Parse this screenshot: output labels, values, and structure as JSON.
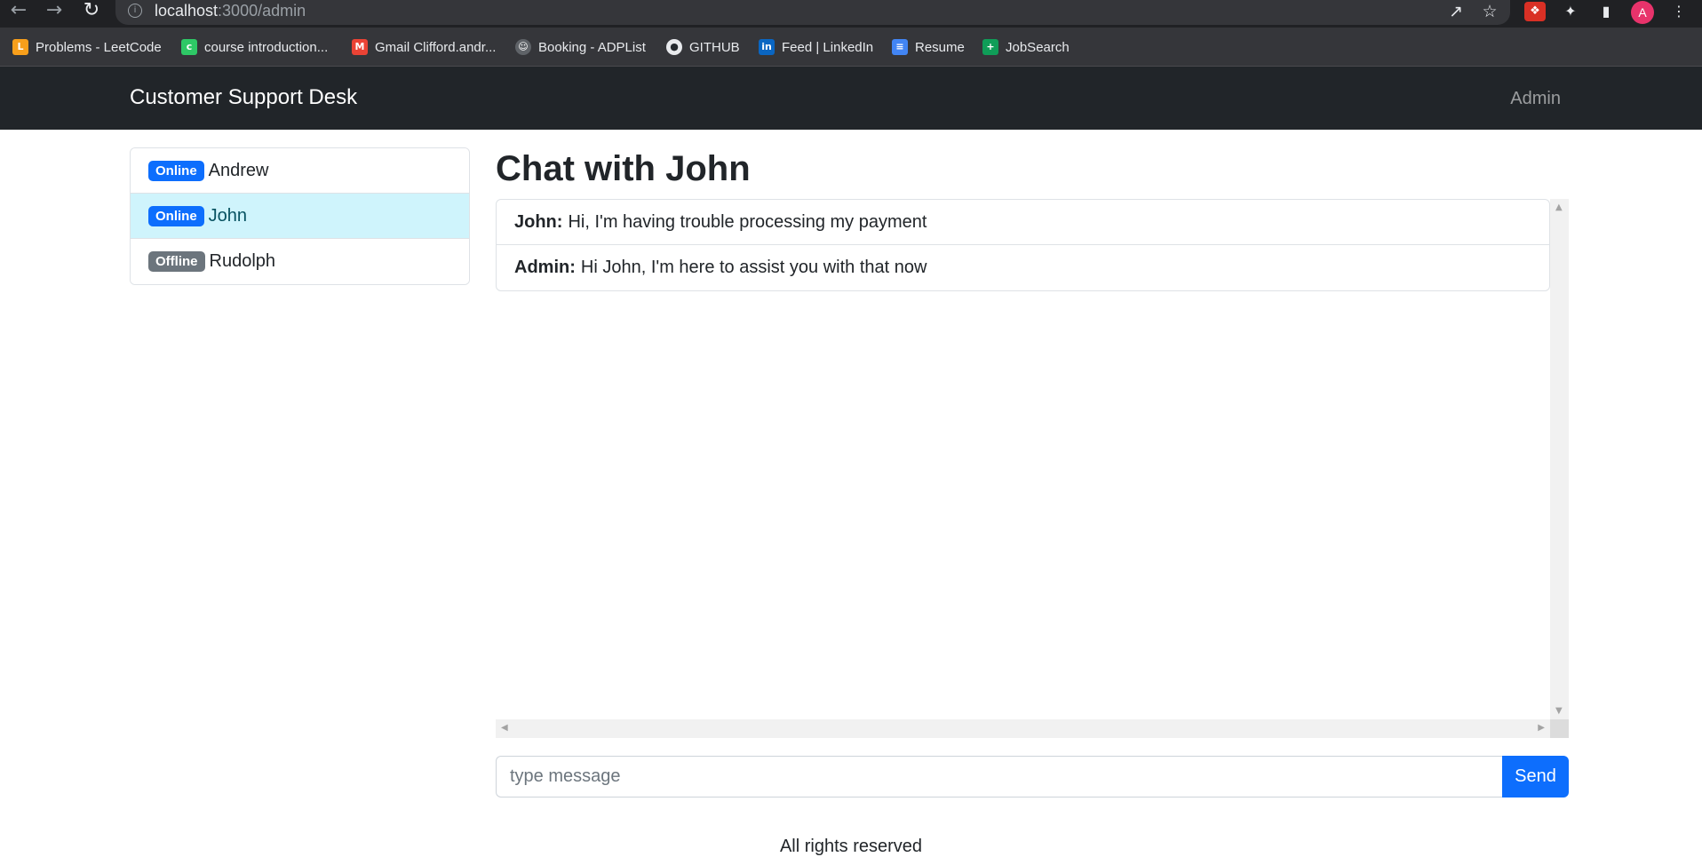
{
  "browser": {
    "url_host": "localhost",
    "url_path": ":3000/admin",
    "profile_initial": "A",
    "bookmarks": [
      {
        "label": "Problems - LeetCode",
        "icon": "leetcode-icon",
        "color": "#f89f1b"
      },
      {
        "label": "course introduction...",
        "icon": "course-icon",
        "color": "#2ec866"
      },
      {
        "label": "Gmail Clifford.andr...",
        "icon": "gmail-icon",
        "color": "#ea4335"
      },
      {
        "label": "Booking - ADPList",
        "icon": "adplist-icon",
        "color": "#5f6368"
      },
      {
        "label": "GITHUB",
        "icon": "github-icon",
        "color": "#24292e"
      },
      {
        "label": "Feed | LinkedIn",
        "icon": "linkedin-icon",
        "color": "#0a66c2"
      },
      {
        "label": "Resume",
        "icon": "docs-icon",
        "color": "#4285f4"
      },
      {
        "label": "JobSearch",
        "icon": "sheets-icon",
        "color": "#0f9d58"
      }
    ]
  },
  "navbar": {
    "brand": "Customer Support Desk",
    "admin_link": "Admin"
  },
  "users": [
    {
      "status": "Online",
      "name": "Andrew",
      "active": false
    },
    {
      "status": "Online",
      "name": "John",
      "active": true
    },
    {
      "status": "Offline",
      "name": "Rudolph",
      "active": false
    }
  ],
  "chat": {
    "title": "Chat with John",
    "messages": [
      {
        "sender": "John:",
        "text": "Hi, I'm having trouble processing my payment"
      },
      {
        "sender": "Admin:",
        "text": "Hi John, I'm here to assist you with that now"
      }
    ],
    "input_placeholder": "type message",
    "input_value": "",
    "send_label": "Send"
  },
  "footer": {
    "text": "All rights reserved"
  },
  "colors": {
    "primary": "#0d6efd",
    "secondary": "#6c757d",
    "navbar_bg": "#212529",
    "active_item_bg": "#cff4fc"
  }
}
